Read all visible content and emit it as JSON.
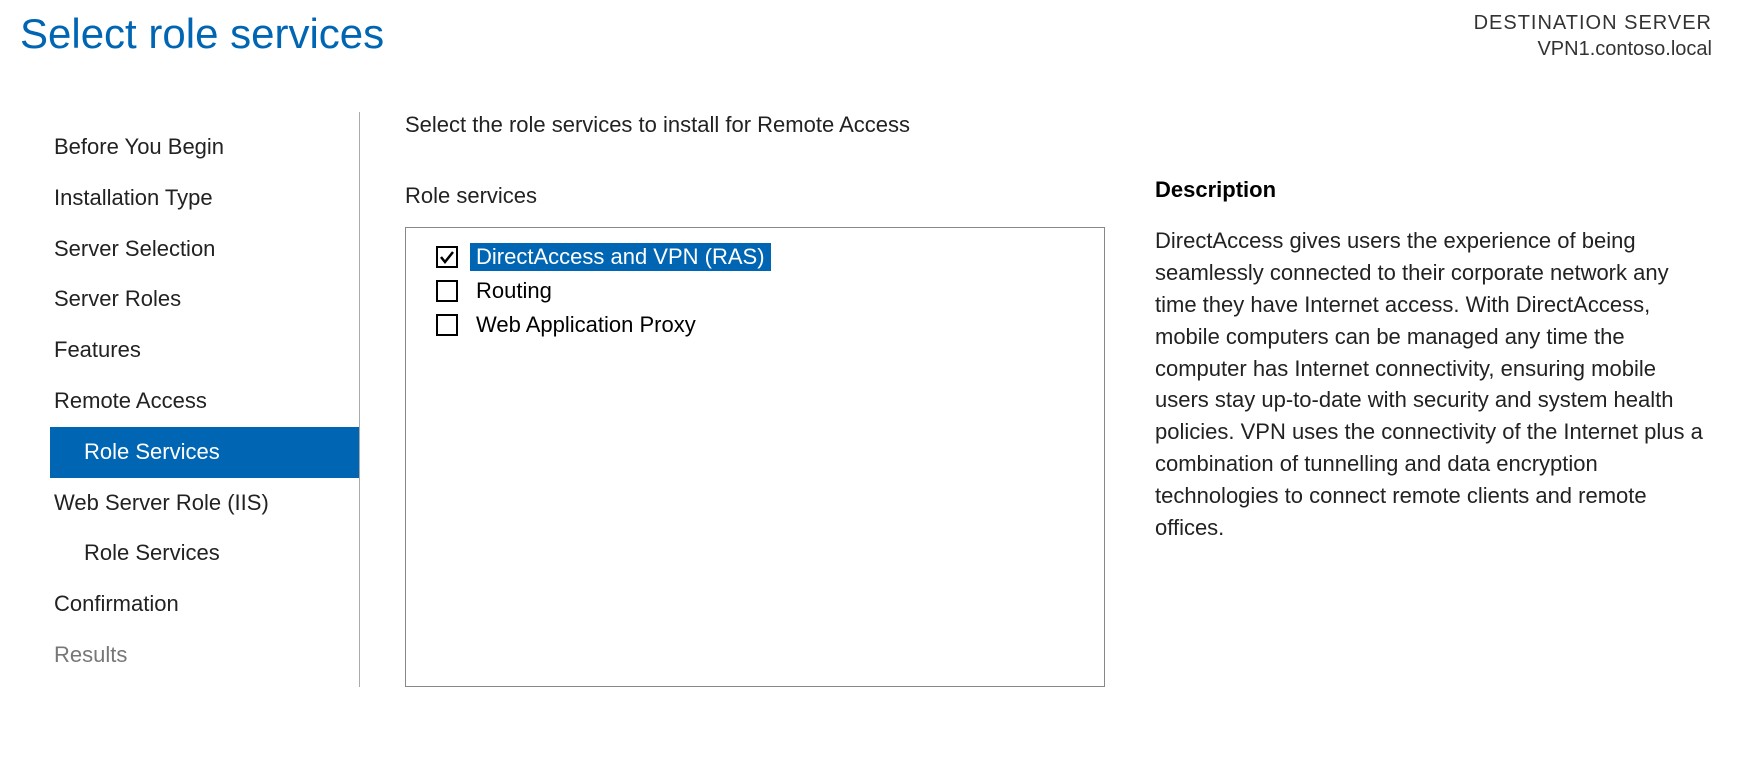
{
  "header": {
    "title": "Select role services",
    "destination_label": "DESTINATION SERVER",
    "destination_server": "VPN1.contoso.local"
  },
  "nav": {
    "items": [
      {
        "label": "Before You Begin",
        "sub": false,
        "selected": false,
        "disabled": false
      },
      {
        "label": "Installation Type",
        "sub": false,
        "selected": false,
        "disabled": false
      },
      {
        "label": "Server Selection",
        "sub": false,
        "selected": false,
        "disabled": false
      },
      {
        "label": "Server Roles",
        "sub": false,
        "selected": false,
        "disabled": false
      },
      {
        "label": "Features",
        "sub": false,
        "selected": false,
        "disabled": false
      },
      {
        "label": "Remote Access",
        "sub": false,
        "selected": false,
        "disabled": false
      },
      {
        "label": "Role Services",
        "sub": true,
        "selected": true,
        "disabled": false
      },
      {
        "label": "Web Server Role (IIS)",
        "sub": false,
        "selected": false,
        "disabled": false
      },
      {
        "label": "Role Services",
        "sub": true,
        "selected": false,
        "disabled": false
      },
      {
        "label": "Confirmation",
        "sub": false,
        "selected": false,
        "disabled": false
      },
      {
        "label": "Results",
        "sub": false,
        "selected": false,
        "disabled": true
      }
    ]
  },
  "content": {
    "instruction": "Select the role services to install for Remote Access",
    "roles_label": "Role services",
    "roles": [
      {
        "label": "DirectAccess and VPN (RAS)",
        "checked": true,
        "highlight": true
      },
      {
        "label": "Routing",
        "checked": false,
        "highlight": false
      },
      {
        "label": "Web Application Proxy",
        "checked": false,
        "highlight": false
      }
    ],
    "description_heading": "Description",
    "description_text": "DirectAccess gives users the experience of being seamlessly connected to their corporate network any time they have Internet access. With DirectAccess, mobile computers can be managed any time the computer has Internet connectivity, ensuring mobile users stay up-to-date with security and system health policies. VPN uses the connectivity of the Internet plus a combination of tunnelling and data encryption technologies to connect remote clients and remote offices."
  }
}
